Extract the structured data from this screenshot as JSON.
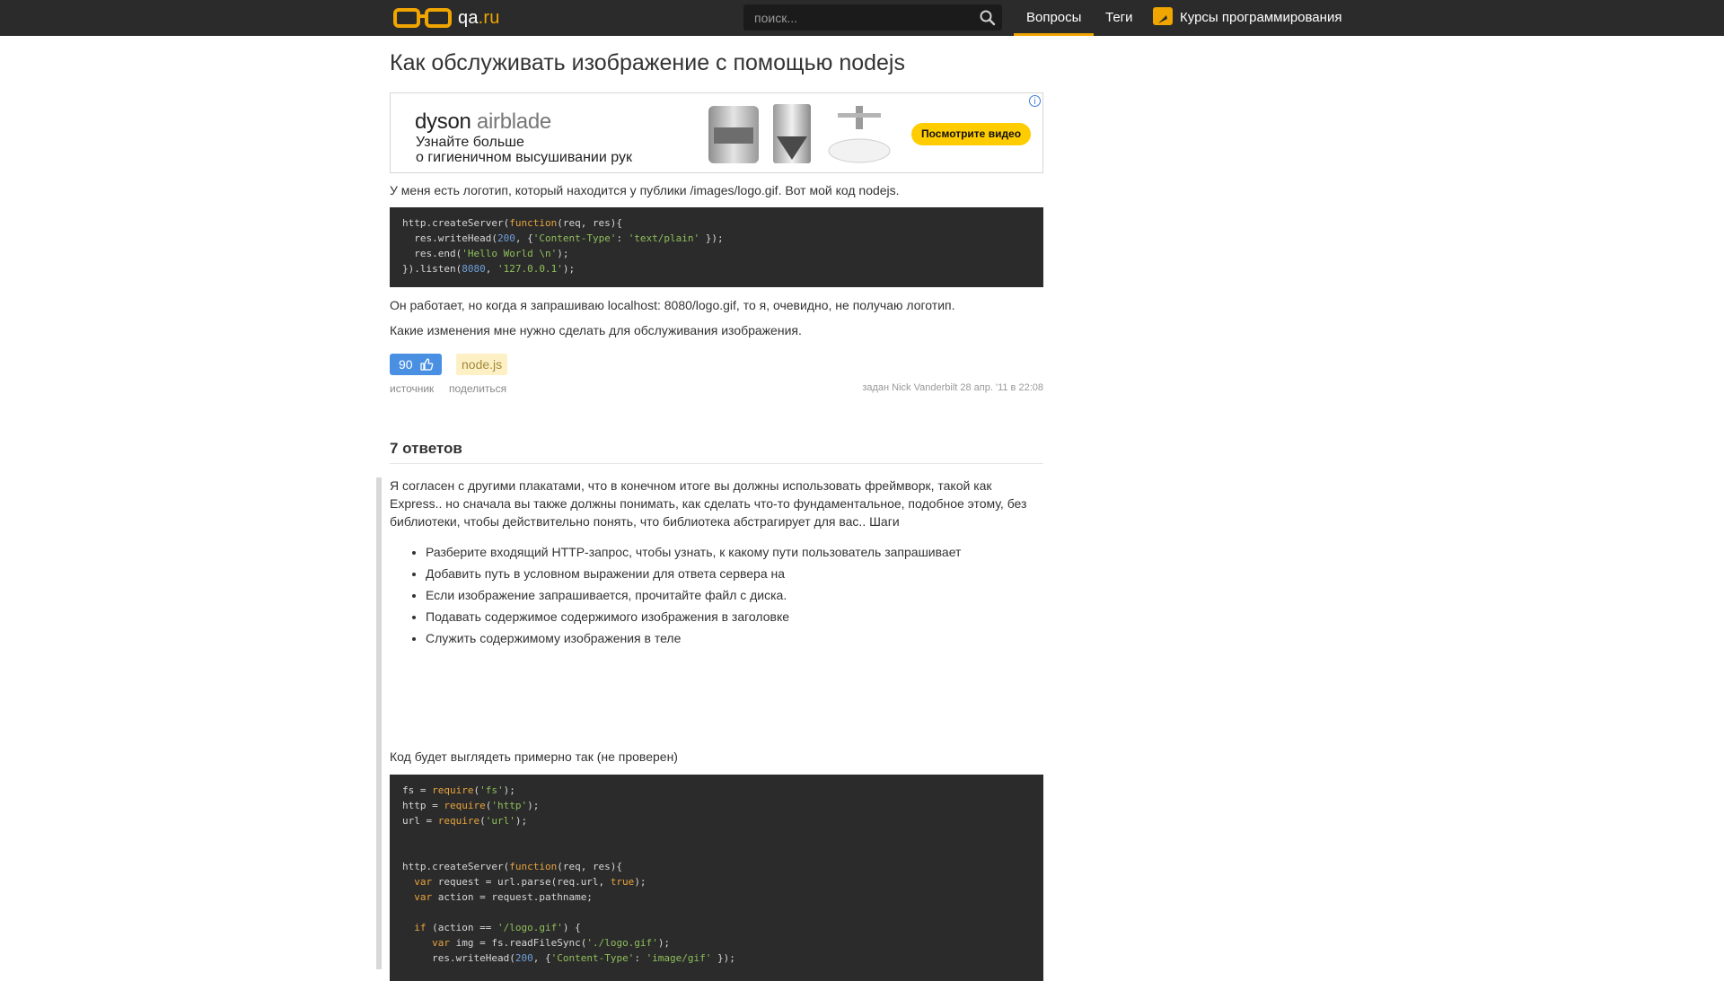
{
  "header": {
    "logo_text": "qa",
    "logo_suffix": ".ru",
    "search_placeholder": "поиск...",
    "nav": {
      "questions": "Вопросы",
      "tags": "Теги",
      "courses": "Курсы программирования"
    }
  },
  "question": {
    "title": "Как обслуживать изображение с помощью nodejs",
    "intro": "У меня есть логотип, который находится у публики /images/logo.gif. Вот мой код nodejs.",
    "code": [
      "http.createServer(function(req, res){",
      "  res.writeHead(200, {'Content-Type': 'text/plain' });",
      "  res.end('Hello World \\n');",
      "}).listen(8080, '127.0.0.1');"
    ],
    "after_code_1": "Он работает, но когда я запрашиваю localhost: 8080/logo.gif, то я, очевидно, не получаю логотип.",
    "after_code_2": "Какие изменения мне нужно сделать для обслуживания изображения.",
    "votes": "90",
    "tag": "node.js",
    "source_link": "источник",
    "share_link": "поделиться",
    "asked_info": "задан Nick Vanderbilt 28 апр. '11 в 22:08"
  },
  "ad": {
    "brand_1": "dyson",
    "brand_2": "airblade",
    "line_1": "Узнайте больше",
    "line_2": "о гигиеничном высушивании рук",
    "cta": "Посмотрите видео",
    "info": "i"
  },
  "answers": {
    "heading": "7 ответов",
    "first": {
      "text": "Я согласен с другими плакатами, что в конечном итоге вы должны использовать фреймворк, такой как Express.. но сначала вы также должны понимать, как сделать что-то фундаментальное, подобное этому, без библиотеки, чтобы действительно понять, что библиотека абстрагирует для вас.. Шаги",
      "steps": [
        "Разберите входящий HTTP-запрос, чтобы узнать, к какому пути пользователь запрашивает",
        "Добавить путь в условном выражении для ответа сервера на",
        "Если изображение запрашивается, прочитайте файл с диска.",
        "Подавать содержимое содержимого изображения в заголовке",
        "Служить содержимому изображения в теле"
      ],
      "code_intro": "Код будет выглядеть примерно так (не проверен)",
      "code": [
        "fs = require('fs');",
        "http = require('http');",
        "url = require('url');",
        "",
        "",
        "http.createServer(function(req, res){",
        "  var request = url.parse(req.url, true);",
        "  var action = request.pathname;",
        "",
        "  if (action == '/logo.gif') {",
        "     var img = fs.readFileSync('./logo.gif');",
        "     res.writeHead(200, {'Content-Type': 'image/gif' });"
      ]
    }
  },
  "colors": {
    "header_bg": "#2b2b2b",
    "accent": "#f0a500",
    "code_bg": "#2b2b2b",
    "vote_bg": "#4a90e2",
    "tag_bg": "#fdf0c5"
  }
}
